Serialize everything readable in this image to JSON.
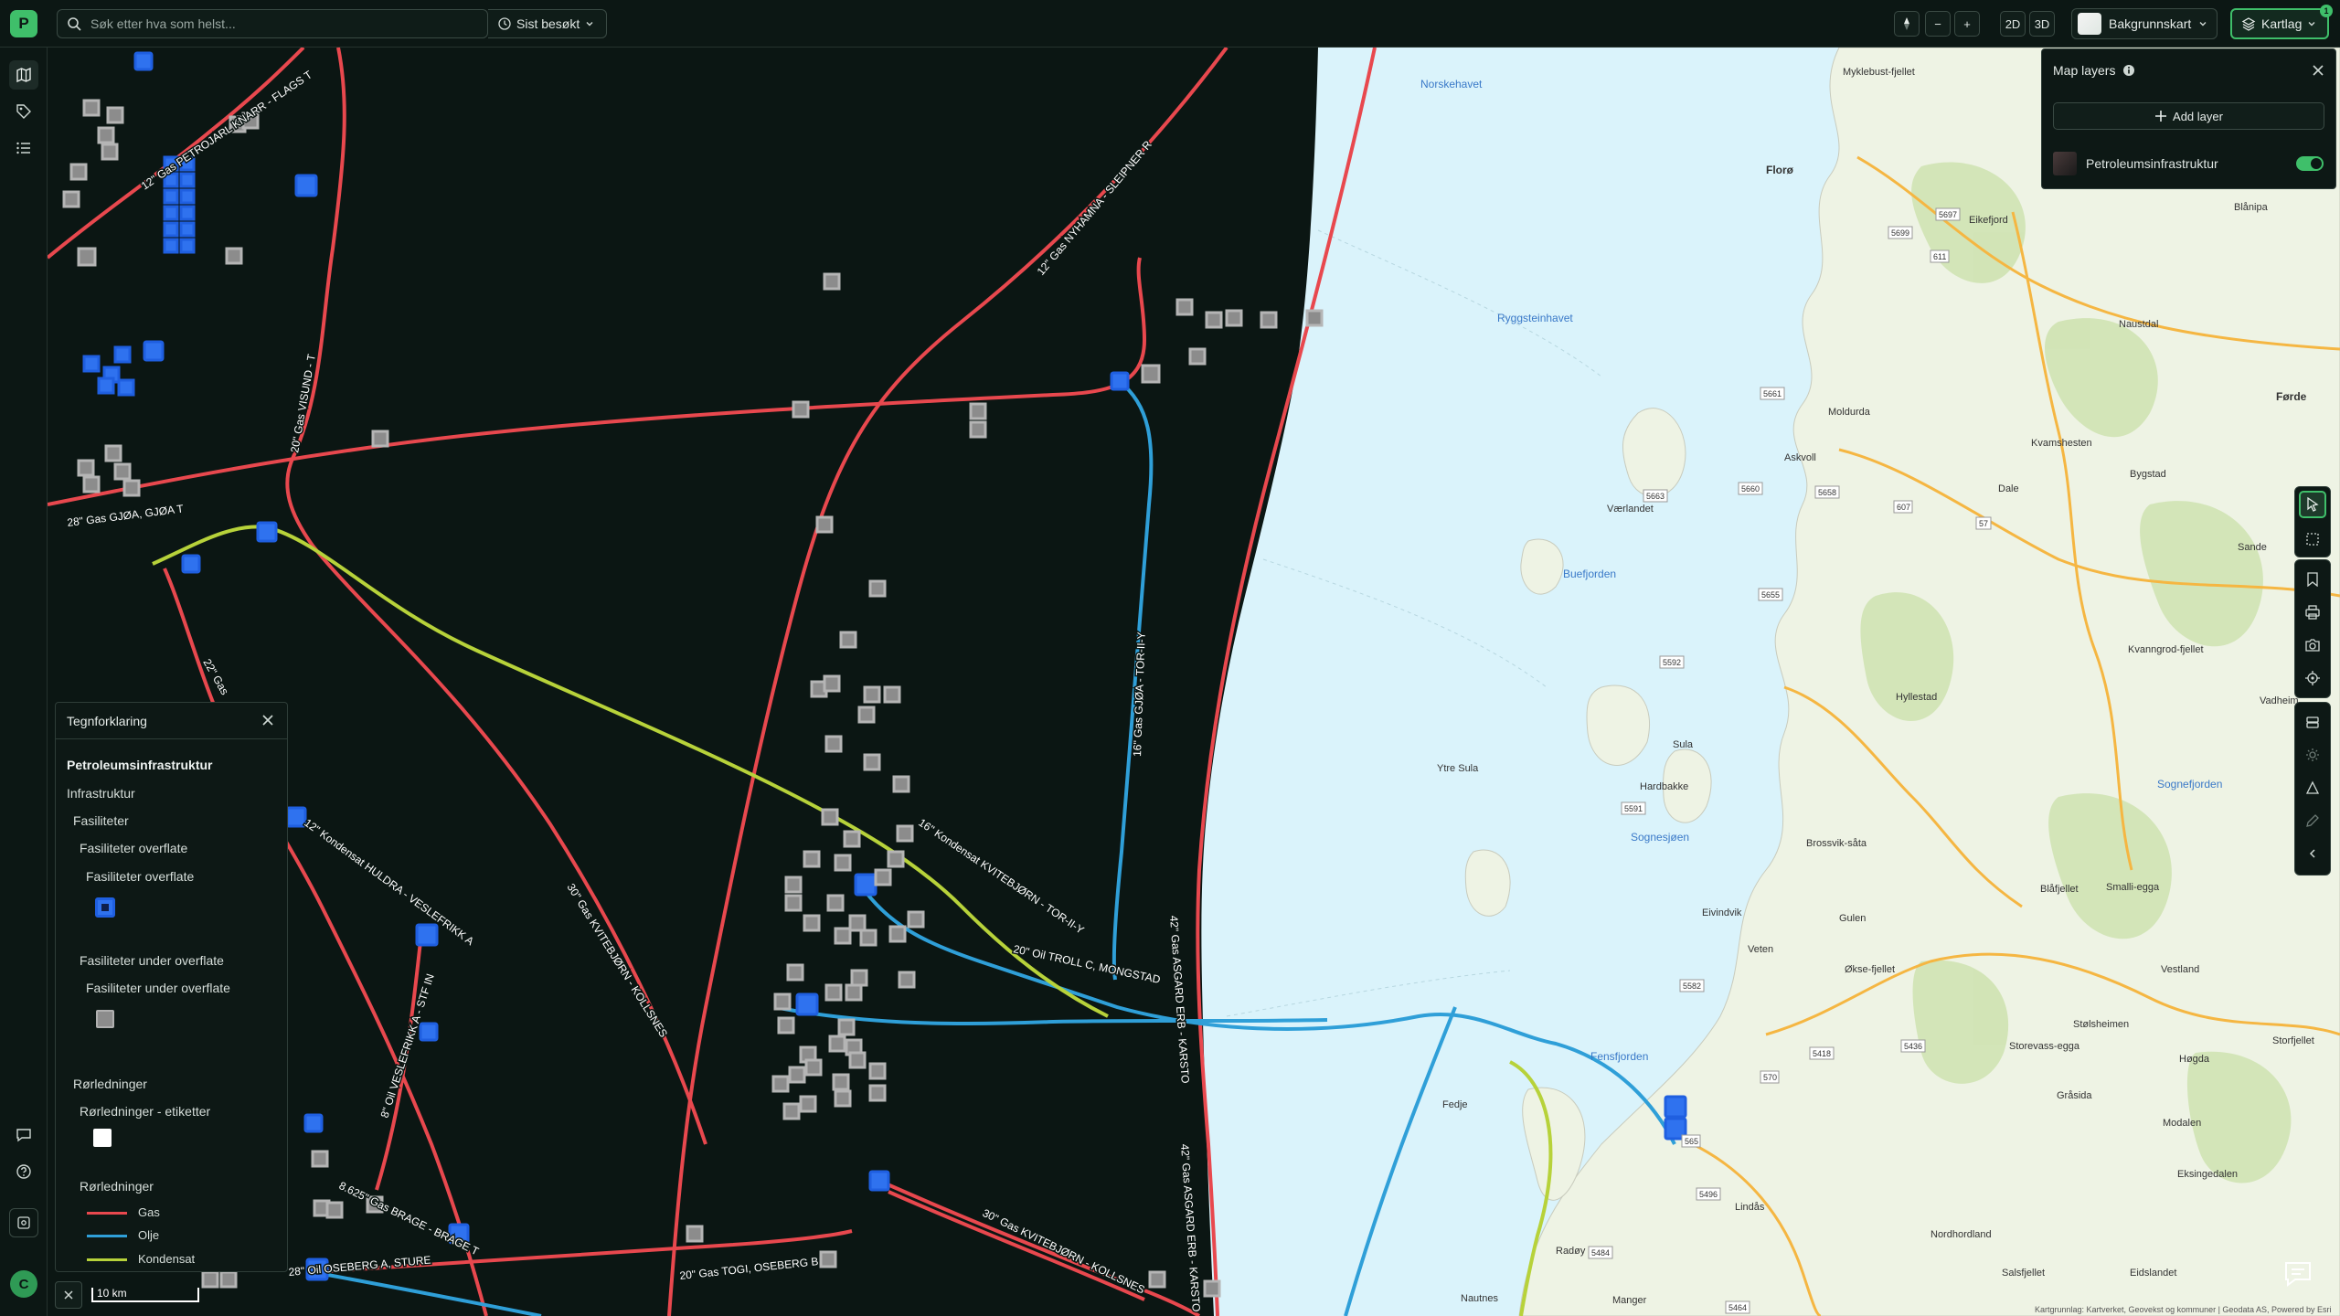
{
  "topbar": {
    "search_placeholder": "Søk etter hva som helst...",
    "recent_label": "Sist besøkt",
    "view_2d": "2D",
    "view_3d": "3D",
    "zoom_out": "−",
    "zoom_in": "+",
    "basemap_label": "Bakgrunnskart",
    "layers_label": "Kartlag",
    "layers_badge": "1"
  },
  "user": {
    "initial": "C"
  },
  "legend": {
    "title": "Tegnforklaring",
    "layer": "Petroleumsinfrastruktur",
    "group": "Infrastruktur",
    "facilities": "Fasiliteter",
    "surface": "Fasiliteter overflate",
    "surface_sub": "Fasiliteter overflate",
    "under": "Fasiliteter under overflate",
    "under_sub": "Fasiliteter under overflate",
    "pipelines": "Rørledninger",
    "pipeline_labels": "Rørledninger - etiketter",
    "pipelines2": "Rørledninger",
    "items": [
      {
        "label": "Gas",
        "color": "#e8484e"
      },
      {
        "label": "Olje",
        "color": "#2f9fd8"
      },
      {
        "label": "Kondensat",
        "color": "#b7d23a"
      }
    ]
  },
  "scale": {
    "label": "10 km"
  },
  "layers_panel": {
    "title": "Map layers",
    "add_label": "Add layer",
    "layer_name": "Petroleumsinfrastruktur"
  },
  "map": {
    "pipeline_labels": [
      "12\" Gas PETROJARL KNARR - FLAGS T",
      "12\" Gas NYHAMNA - SLEIPNER R",
      "20\" Gas VISUND - T",
      "28\" Gas GJØA, GJØA T",
      "22\" Gas",
      "16\" Gas GJØA - TOR-II-Y",
      "16\" Kondensat KVITEBJØRN - TOR-II-Y",
      "20\" Oil TROLL C, MONGSTAD",
      "30\" Gas KVITEBJØRN - KOLLSNES",
      "12\" Kondensat HULDRA - VESLEFRIKK A",
      "8\" Oil VESLEFRIKK A - STF IN",
      "8.625\" Gas BRAGE - BRAGE T",
      "28\" Oil OSEBERG A, STURE",
      "20\" Gas TOGI, OSEBERG B",
      "30\" Gas KVITEBJØRN - KOLLSNES",
      "42\" Gas ASGARD ERB - KARSTO",
      "42\" Gas ASGARD ERB - KARSTO"
    ],
    "sea_labels": [
      "Norskehavet",
      "Ryggsteinhavet",
      "Buefjorden",
      "Sognesjøen",
      "Fensfjorden",
      "Sognefjorden"
    ],
    "place_labels": [
      "Florø",
      "Eikefjord",
      "Naustdal",
      "Førde",
      "Moldurda",
      "Askvoll",
      "Værlandet",
      "Dale",
      "Bygstad",
      "Sande",
      "Hyllestad",
      "Ytre Sula",
      "Sula",
      "Hardbakke",
      "Brossvik-såta",
      "Gulen",
      "Eivindvik",
      "Veten",
      "Økse-fjellet",
      "Fedje",
      "Lindås",
      "Radøy",
      "Nautnes",
      "Manger",
      "Vestland",
      "Stølsheimen",
      "Høgda",
      "Modalen",
      "Eksingedalen",
      "Nordhordland",
      "Eidslandet",
      "Salsfjellet",
      "Storfjellet",
      "Vadheim",
      "Kvamshesten",
      "Blåfjellet",
      "Myklebust-fjellet",
      "Blånipa",
      "Kvanngrod-fjellet",
      "Smalli-egga",
      "Storevass-egga",
      "Gråsida"
    ],
    "road_numbers": [
      "5697",
      "611",
      "5699",
      "5661",
      "5663",
      "5660",
      "5658",
      "607",
      "57",
      "5655",
      "5592",
      "5591",
      "5582",
      "570",
      "5436",
      "5418",
      "565",
      "5484",
      "5464",
      "5496"
    ],
    "attribution": "Kartgrunnlag: Kartverket, Geovekst og kommuner | Geodata AS, Powered by Esri"
  }
}
